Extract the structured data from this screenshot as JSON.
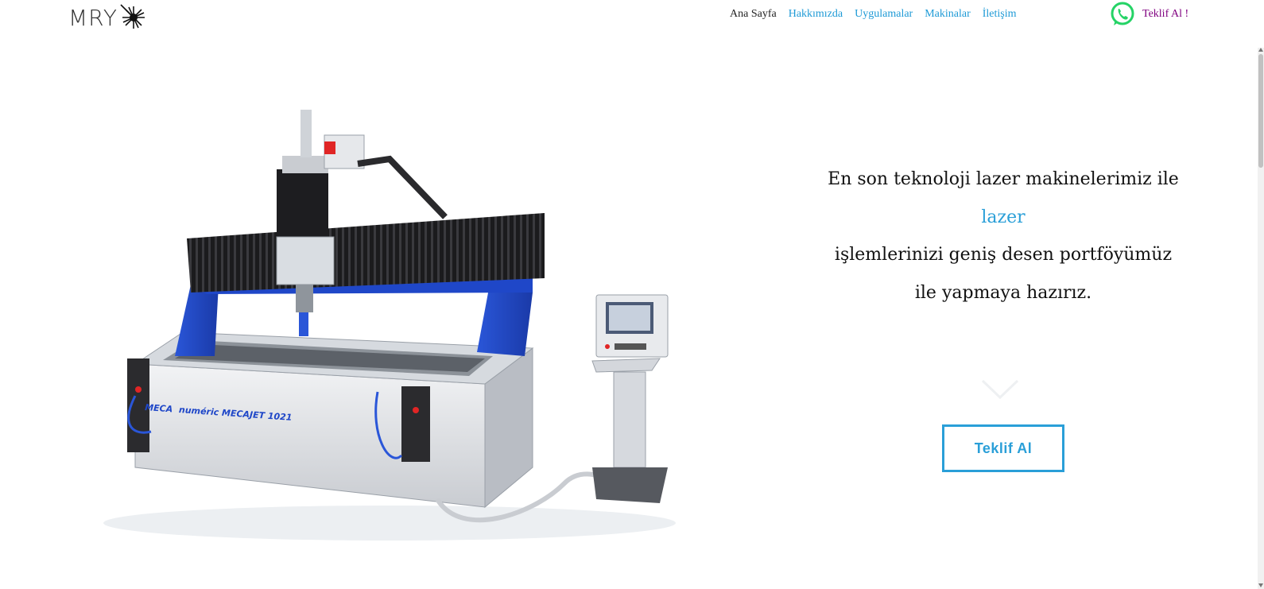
{
  "header": {
    "logo_text": "MRY",
    "nav": [
      {
        "label": "Ana Sayfa",
        "active": true
      },
      {
        "label": "Hakkımızda"
      },
      {
        "label": "Uygulamalar"
      },
      {
        "label": "Makinalar"
      },
      {
        "label": "İletişim"
      }
    ],
    "cta_label": "Teklif Al !",
    "cta_icon": "whatsapp-icon"
  },
  "hero": {
    "line1": "En son teknoloji lazer makinelerimiz ile",
    "line2": "lazer",
    "line3": "işlemlerinizi geniş desen portföyümüz",
    "line4": "ile yapmaya hazırız.",
    "machine_brand": "MECA",
    "machine_label": "numéric MECAJET 1021",
    "button_label": "Teklif Al",
    "scroll_icon": "chevron-down-icon"
  },
  "colors": {
    "accent": "#2a9fd8",
    "nav_link": "#1e9ad6",
    "cta_top": "#800080",
    "whatsapp": "#25d366",
    "machine_blue": "#1f47c8"
  }
}
